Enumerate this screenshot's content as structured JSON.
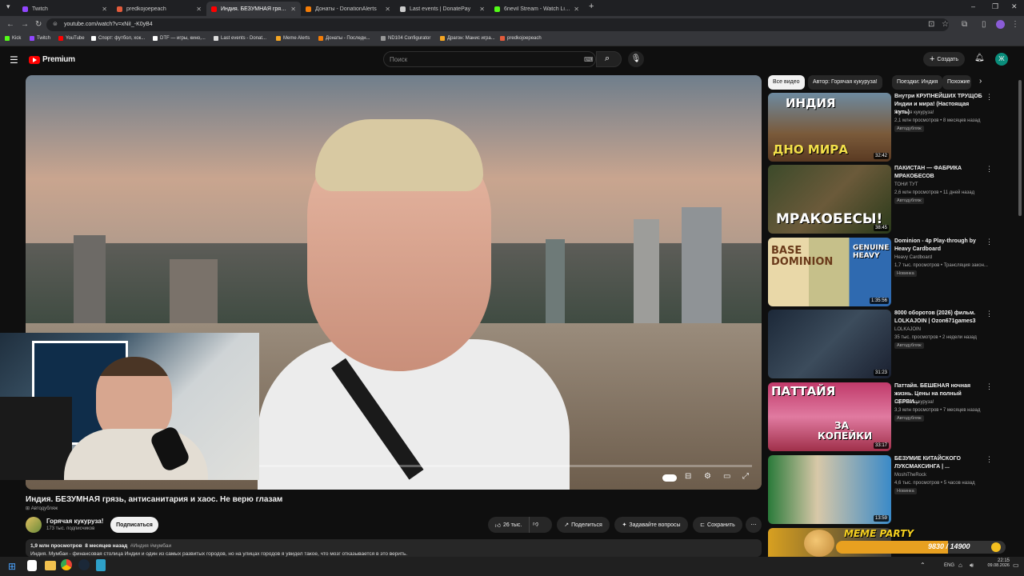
{
  "tabs": [
    {
      "label": "Twitch",
      "color": "#9146ff"
    },
    {
      "label": "predkojoepeach",
      "color": "#e35b3b"
    },
    {
      "label": "Индия. БЕЗУМНАЯ грязь, антисанитария и хаос. Не верю глазам",
      "color": "#ff0000"
    },
    {
      "label": "Донаты - DonationAlerts",
      "color": "#f57d07"
    },
    {
      "label": "Last events | DonatePay",
      "color": "#cccccc"
    },
    {
      "label": "6nevil Stream - Watch Live on Kick",
      "color": "#53fc18"
    }
  ],
  "address": {
    "url": "youtube.com/watch?v=xNiI_-K0yB4"
  },
  "bookmarks": [
    {
      "label": "Kick",
      "color": "#53fc18"
    },
    {
      "label": "Twitch",
      "color": "#9146ff"
    },
    {
      "label": "YouTube",
      "color": "#ff0000"
    },
    {
      "label": "Спорт: футбол, хок...",
      "color": "#ffffff"
    },
    {
      "label": "DTF — игры, кино,...",
      "color": "#ffffff"
    },
    {
      "label": "Last events - Donat...",
      "color": "#ffffff"
    },
    {
      "label": "Meme Alerts",
      "color": "#f5a623"
    },
    {
      "label": "Донаты - Последн...",
      "color": "#f57d07"
    },
    {
      "label": "ND104 Configurator",
      "color": "#999999"
    },
    {
      "label": "Драгон: Манис игра...",
      "color": "#f5a623"
    },
    {
      "label": "predkojoepeach",
      "color": "#e35b3b"
    }
  ],
  "header": {
    "logo": "Premium",
    "search_placeholder": "Поиск",
    "create_label": "Создать",
    "avatar_letter": "Ж"
  },
  "chips": [
    "Все видео",
    "Автор: Горячая кукуруза!",
    "Поездки: Индия",
    "Похожие"
  ],
  "recommendations": [
    {
      "title": "Внутри КРУПНЕЙШИХ ТРУЩОБ Индии и мира! (Настоящая жуть)",
      "channel": "Горячая кукуруза!",
      "meta": "2,1 млн просмотров • 8 месяцев назад",
      "badge": "Автодубляж",
      "duration": "32:42",
      "thumb_top": "ИНДИЯ",
      "thumb_bottom": "ДНО МИРА"
    },
    {
      "title": "ПАКИСТАН — ФАБРИКА МРАКОБЕСОВ",
      "channel": "ТОНИ ТУТ",
      "meta": "2,6 млн просмотров • 11 дней назад",
      "badge": "Автодубляж",
      "duration": "38:45",
      "thumb_top": "",
      "thumb_bottom": "МРАКОБЕСЫ!"
    },
    {
      "title": "Dominion - 4p Play-through by Heavy Cardboard",
      "channel": "Heavy Cardboard",
      "meta": "1,7 тыс. просмотров • Трансляция закон...",
      "badge": "Новинка",
      "duration": "1:35:56",
      "thumb_top": "BASE DOMINION",
      "thumb_bottom": "GENUINE HEAVY"
    },
    {
      "title": "8000 оборотов (2026) фильм. LOLKAJOIN | Ozon671games3",
      "channel": "LOLKAJOIN",
      "meta": "35 тыс. просмотров • 2 недели назад",
      "badge": "Автодубляж",
      "duration": "31:23",
      "thumb_top": "",
      "thumb_bottom": ""
    },
    {
      "title": "Паттайя. БЕШЕНАЯ ночная жизнь. Цены на полный СЕРВИ...",
      "channel": "Горячая кукуруза!",
      "meta": "3,3 млн просмотров • 7 месяцев назад",
      "badge": "Автодубляж",
      "duration": "33:17",
      "thumb_top": "ПАТТАЙЯ",
      "thumb_bottom": "ЗА КОПЕЙКИ"
    },
    {
      "title": "БЕЗУМИЕ КИТАЙСКОГО ЛУКСМАКСИНГА | ...",
      "channel": "MoshiTheRock",
      "meta": "4,6 тыс. просмотров • 5 часов назад",
      "badge": "Новинка",
      "duration": "13:59",
      "thumb_top": "",
      "thumb_bottom": ""
    }
  ],
  "video": {
    "title": "Индия. БЕЗУМНАЯ грязь, антисанитария и хаос. Не верю глазам",
    "dub_badge": "Автодубляж",
    "channel": "Горячая кукуруза!",
    "subs": "173 тыс. подписчиков",
    "subscribe_label": "Подписаться",
    "likes": "26 тыс.",
    "share_label": "Поделиться",
    "ask_label": "Задавайте вопросы",
    "save_label": "Сохранить",
    "views": "1,9 млн просмотров",
    "ago": "8 месяцев назад",
    "tags": "#Индия #мумбаи",
    "description": "Индия. Мумбаи - финансовая столица Индии и один из самых развитых городов, но на улицах городов я увидел такое, что мозг отказывается в это верить."
  },
  "overlay": {
    "meme_label": "MEME PARTY",
    "goal": "9830 / 14900"
  },
  "taskbar": {
    "lang": "ENG",
    "time": "22:15",
    "date": "09.08.2026"
  },
  "accent": "#ff0000"
}
